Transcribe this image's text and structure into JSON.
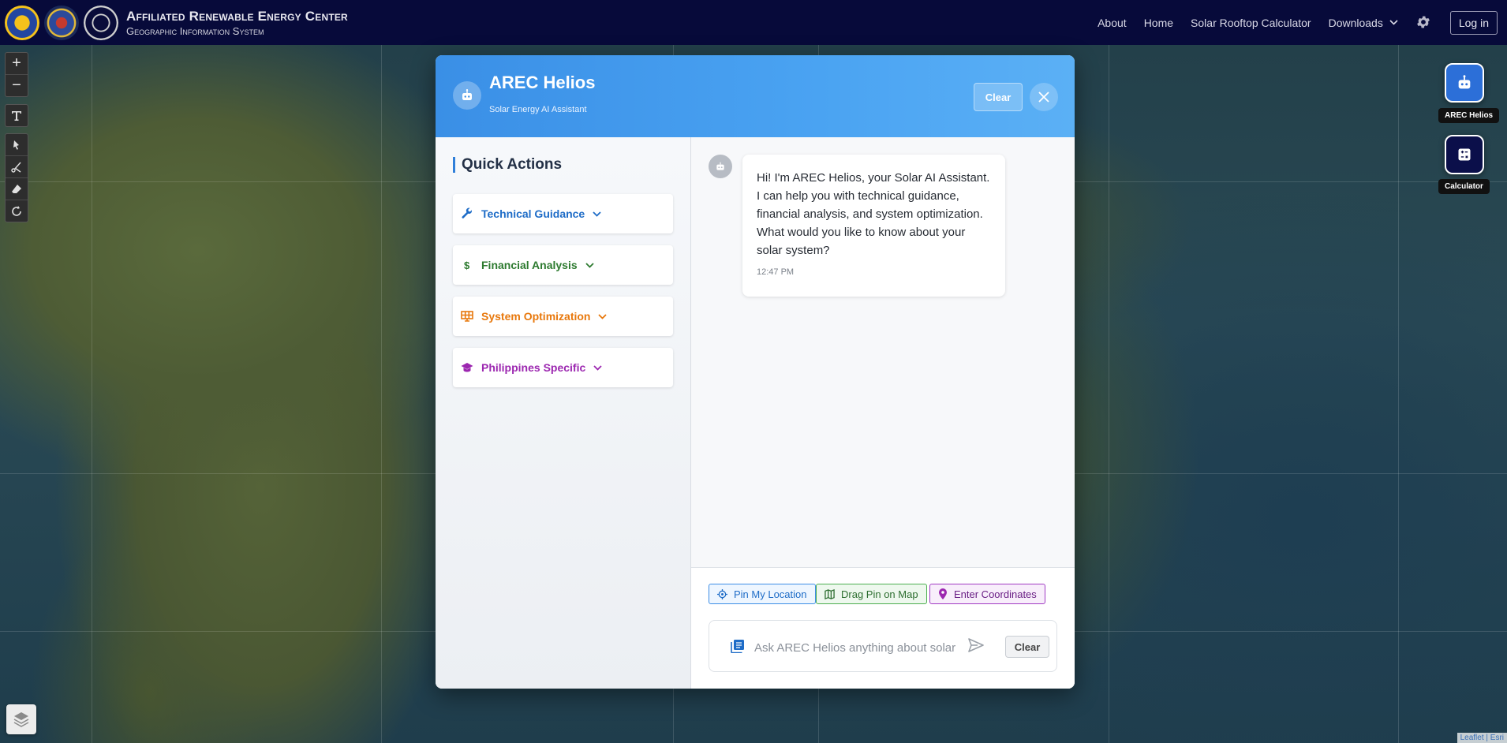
{
  "header": {
    "title_line1": "Affiliated Renewable Energy Center",
    "title_line2": "Geographic Information System",
    "nav": {
      "about": "About",
      "home": "Home",
      "calculator": "Solar Rooftop Calculator",
      "downloads": "Downloads",
      "login": "Log in"
    }
  },
  "map": {
    "zoom_in": "+",
    "zoom_out": "−",
    "attribution": "Leaflet | Esri"
  },
  "floating": {
    "helios_label": "AREC Helios",
    "calculator_label": "Calculator"
  },
  "modal": {
    "title": "AREC Helios",
    "subtitle": "Solar Energy AI Assistant",
    "clear_label": "Clear",
    "quick_actions": {
      "title": "Quick Actions",
      "items": [
        {
          "label": "Technical Guidance",
          "color": "#1e6cc7",
          "icon": "wrench-icon"
        },
        {
          "label": "Financial Analysis",
          "color": "#2d7a2f",
          "icon": "dollar-icon"
        },
        {
          "label": "System Optimization",
          "color": "#e8780c",
          "icon": "solar-panel-icon"
        },
        {
          "label": "Philippines Specific",
          "color": "#9c27b0",
          "icon": "graduation-cap-icon"
        }
      ]
    },
    "chat": {
      "message": "Hi! I'm AREC Helios, your Solar AI Assistant. I can help you with technical guidance, financial analysis, and system optimization. What would you like to know about your solar system?",
      "time": "12:47 PM"
    },
    "input": {
      "chips": {
        "pin_location": "Pin My Location",
        "drag_pin": "Drag Pin on Map",
        "enter_coords": "Enter Coordinates"
      },
      "placeholder": "Ask AREC Helios anything about solar energy...",
      "clear_label": "Clear"
    }
  }
}
